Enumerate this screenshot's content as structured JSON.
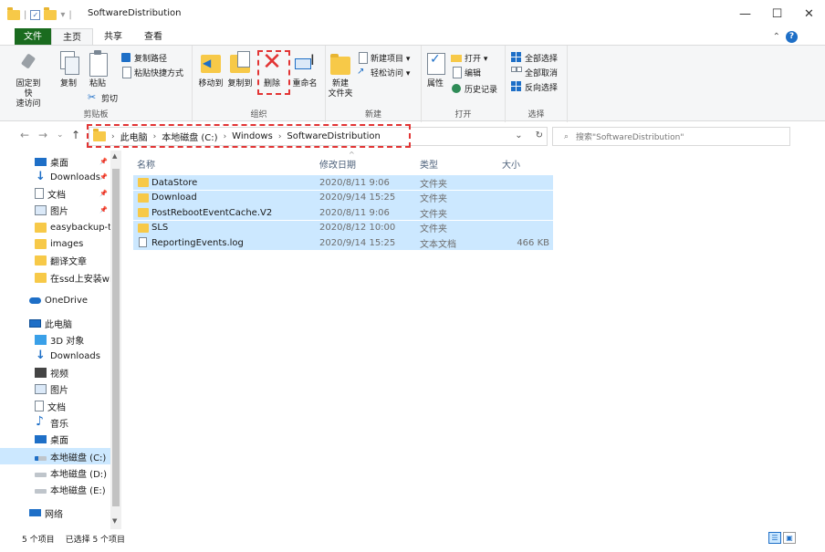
{
  "window": {
    "title": "SoftwareDistribution",
    "minimize": "—",
    "maximize": "☐",
    "close": "✕"
  },
  "tabs": [
    "文件",
    "主页",
    "共享",
    "查看"
  ],
  "ribbon": {
    "clipboard": {
      "label": "剪贴板",
      "pin": "固定到快\n速访问",
      "copy": "复制",
      "paste": "粘贴",
      "copy_path": "复制路径",
      "paste_shortcut": "粘贴快捷方式",
      "cut": "剪切"
    },
    "organize": {
      "label": "组织",
      "move_to": "移动到",
      "copy_to": "复制到",
      "delete": "删除",
      "rename": "重命名"
    },
    "new": {
      "label": "新建",
      "new_folder": "新建\n文件夹",
      "new_item": "新建项目 ▾",
      "easy_access": "轻松访问 ▾"
    },
    "open": {
      "label": "打开",
      "properties": "属性",
      "open": "打开 ▾",
      "edit": "编辑",
      "history": "历史记录"
    },
    "select": {
      "label": "选择",
      "select_all": "全部选择",
      "select_none": "全部取消",
      "invert": "反向选择"
    }
  },
  "address": {
    "crumbs": [
      "此电脑",
      "本地磁盘 (C:)",
      "Windows",
      "SoftwareDistribution"
    ],
    "search_placeholder": "搜索\"SoftwareDistribution\""
  },
  "sidebar": [
    {
      "label": "桌面",
      "icon": "desktop-icon",
      "pinned": true
    },
    {
      "label": "Downloads",
      "icon": "download-icon",
      "pinned": true
    },
    {
      "label": "文档",
      "icon": "document-icon",
      "pinned": true
    },
    {
      "label": "图片",
      "icon": "picture-icon",
      "pinned": true
    },
    {
      "label": "easybackup-tu",
      "icon": "folder-icon",
      "pinned": false
    },
    {
      "label": "images",
      "icon": "folder-icon",
      "pinned": false
    },
    {
      "label": "翻译文章",
      "icon": "folder-icon",
      "pinned": false
    },
    {
      "label": "在ssd上安装win",
      "icon": "folder-icon",
      "pinned": false
    },
    {
      "label": "OneDrive",
      "icon": "onedrive-icon",
      "pinned": false
    },
    {
      "label": "此电脑",
      "icon": "this-pc-icon",
      "pinned": false
    },
    {
      "label": "3D 对象",
      "icon": "3d-objects-icon",
      "pinned": false
    },
    {
      "label": "Downloads",
      "icon": "download-icon",
      "pinned": false
    },
    {
      "label": "视频",
      "icon": "video-icon",
      "pinned": false
    },
    {
      "label": "图片",
      "icon": "picture-icon",
      "pinned": false
    },
    {
      "label": "文档",
      "icon": "document-icon",
      "pinned": false
    },
    {
      "label": "音乐",
      "icon": "music-icon",
      "pinned": false
    },
    {
      "label": "桌面",
      "icon": "desktop-icon",
      "pinned": false
    },
    {
      "label": "本地磁盘 (C:)",
      "icon": "drive-c-icon",
      "pinned": false,
      "selected": true
    },
    {
      "label": "本地磁盘 (D:)",
      "icon": "drive-icon",
      "pinned": false
    },
    {
      "label": "本地磁盘 (E:)",
      "icon": "drive-icon",
      "pinned": false
    },
    {
      "label": "网络",
      "icon": "network-icon",
      "pinned": false
    }
  ],
  "columns": {
    "name": "名称",
    "date": "修改日期",
    "type": "类型",
    "size": "大小"
  },
  "files": [
    {
      "name": "DataStore",
      "date": "2020/8/11 9:06",
      "type": "文件夹",
      "size": "",
      "kind": "folder"
    },
    {
      "name": "Download",
      "date": "2020/9/14 15:25",
      "type": "文件夹",
      "size": "",
      "kind": "folder"
    },
    {
      "name": "PostRebootEventCache.V2",
      "date": "2020/8/11 9:06",
      "type": "文件夹",
      "size": "",
      "kind": "folder"
    },
    {
      "name": "SLS",
      "date": "2020/8/12 10:00",
      "type": "文件夹",
      "size": "",
      "kind": "folder"
    },
    {
      "name": "ReportingEvents.log",
      "date": "2020/9/14 15:25",
      "type": "文本文档",
      "size": "466 KB",
      "kind": "log"
    }
  ],
  "status": {
    "count": "5 个项目",
    "selected": "已选择 5 个项目"
  }
}
